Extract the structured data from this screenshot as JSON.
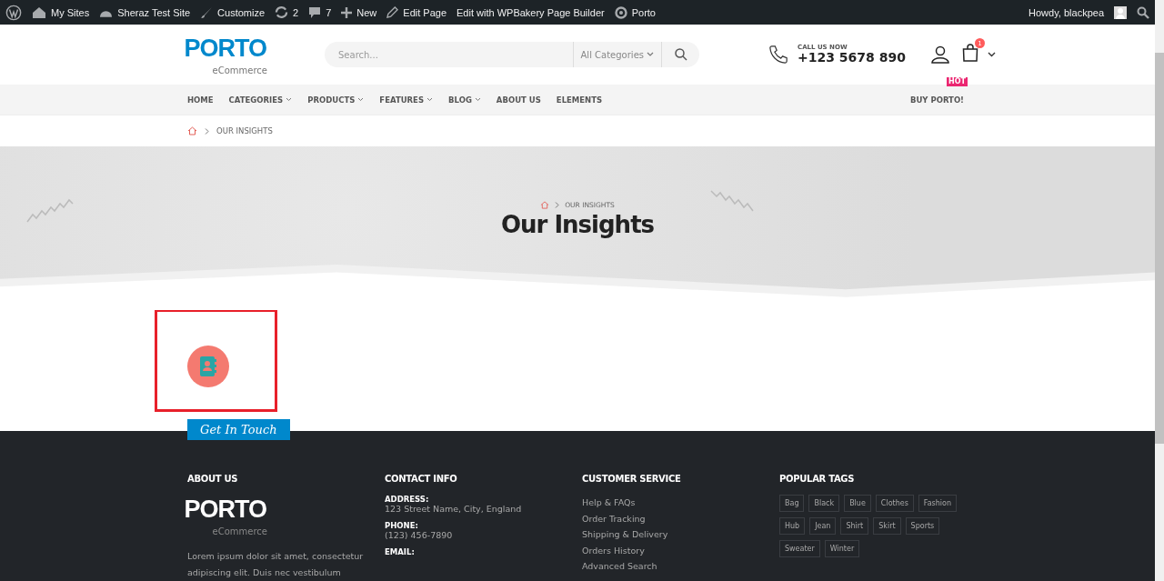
{
  "admin_bar": {
    "items": [
      {
        "kind": "wp"
      },
      {
        "kind": "sites",
        "label": "My Sites"
      },
      {
        "kind": "dashboard",
        "label": "Sheraz Test Site"
      },
      {
        "kind": "brush",
        "label": "Customize"
      },
      {
        "kind": "updates",
        "label": "2"
      },
      {
        "kind": "comments",
        "label": "7"
      },
      {
        "kind": "new",
        "label": "New"
      },
      {
        "kind": "pencil",
        "label": "Edit Page"
      },
      {
        "kind": "plain",
        "label": "Edit with WPBakery Page Builder"
      },
      {
        "kind": "porto",
        "label": "Porto"
      }
    ],
    "greeting": "Howdy, blackpea"
  },
  "header": {
    "logo": "PORTO",
    "logo_sub": "eCommerce",
    "search": {
      "placeholder": "Search...",
      "category": "All Categories"
    },
    "call_label": "CALL US NOW",
    "phone": "+123 5678 890",
    "cart_count": "1"
  },
  "nav": {
    "items": [
      {
        "label": "HOME",
        "dropdown": false
      },
      {
        "label": "CATEGORIES",
        "dropdown": true
      },
      {
        "label": "PRODUCTS",
        "dropdown": true
      },
      {
        "label": "FEATURES",
        "dropdown": true
      },
      {
        "label": "BLOG",
        "dropdown": true
      },
      {
        "label": "ABOUT US",
        "dropdown": false
      },
      {
        "label": "ELEMENTS",
        "dropdown": false
      }
    ],
    "right": {
      "label": "BUY PORTO!",
      "badge": "HOT"
    }
  },
  "breadcrumb": "OUR INSIGHTS",
  "hero": {
    "breadcrumb": "OUR INSIGHTS",
    "title": "Our Insights"
  },
  "get_in_touch": "Get In Touch",
  "footer": {
    "about": {
      "heading": "ABOUT US",
      "logo": "PORTO",
      "logo_sub": "eCommerce",
      "text": "Lorem ipsum dolor sit amet, consectetur adipiscing elit. Duis nec vestibulum"
    },
    "contact": {
      "heading": "CONTACT INFO",
      "fields": [
        {
          "label": "ADDRESS:",
          "value": "123 Street Name, City, England"
        },
        {
          "label": "PHONE:",
          "value": "(123) 456-7890"
        },
        {
          "label": "EMAIL:"
        }
      ]
    },
    "service": {
      "heading": "CUSTOMER SERVICE",
      "links": [
        "Help & FAQs",
        "Order Tracking",
        "Shipping & Delivery",
        "Orders History",
        "Advanced Search"
      ]
    },
    "tags": {
      "heading": "POPULAR TAGS",
      "items": [
        "Bag",
        "Black",
        "Blue",
        "Clothes",
        "Fashion",
        "Hub",
        "Jean",
        "Shirt",
        "Skirt",
        "Sports",
        "Sweater",
        "Winter"
      ]
    }
  }
}
